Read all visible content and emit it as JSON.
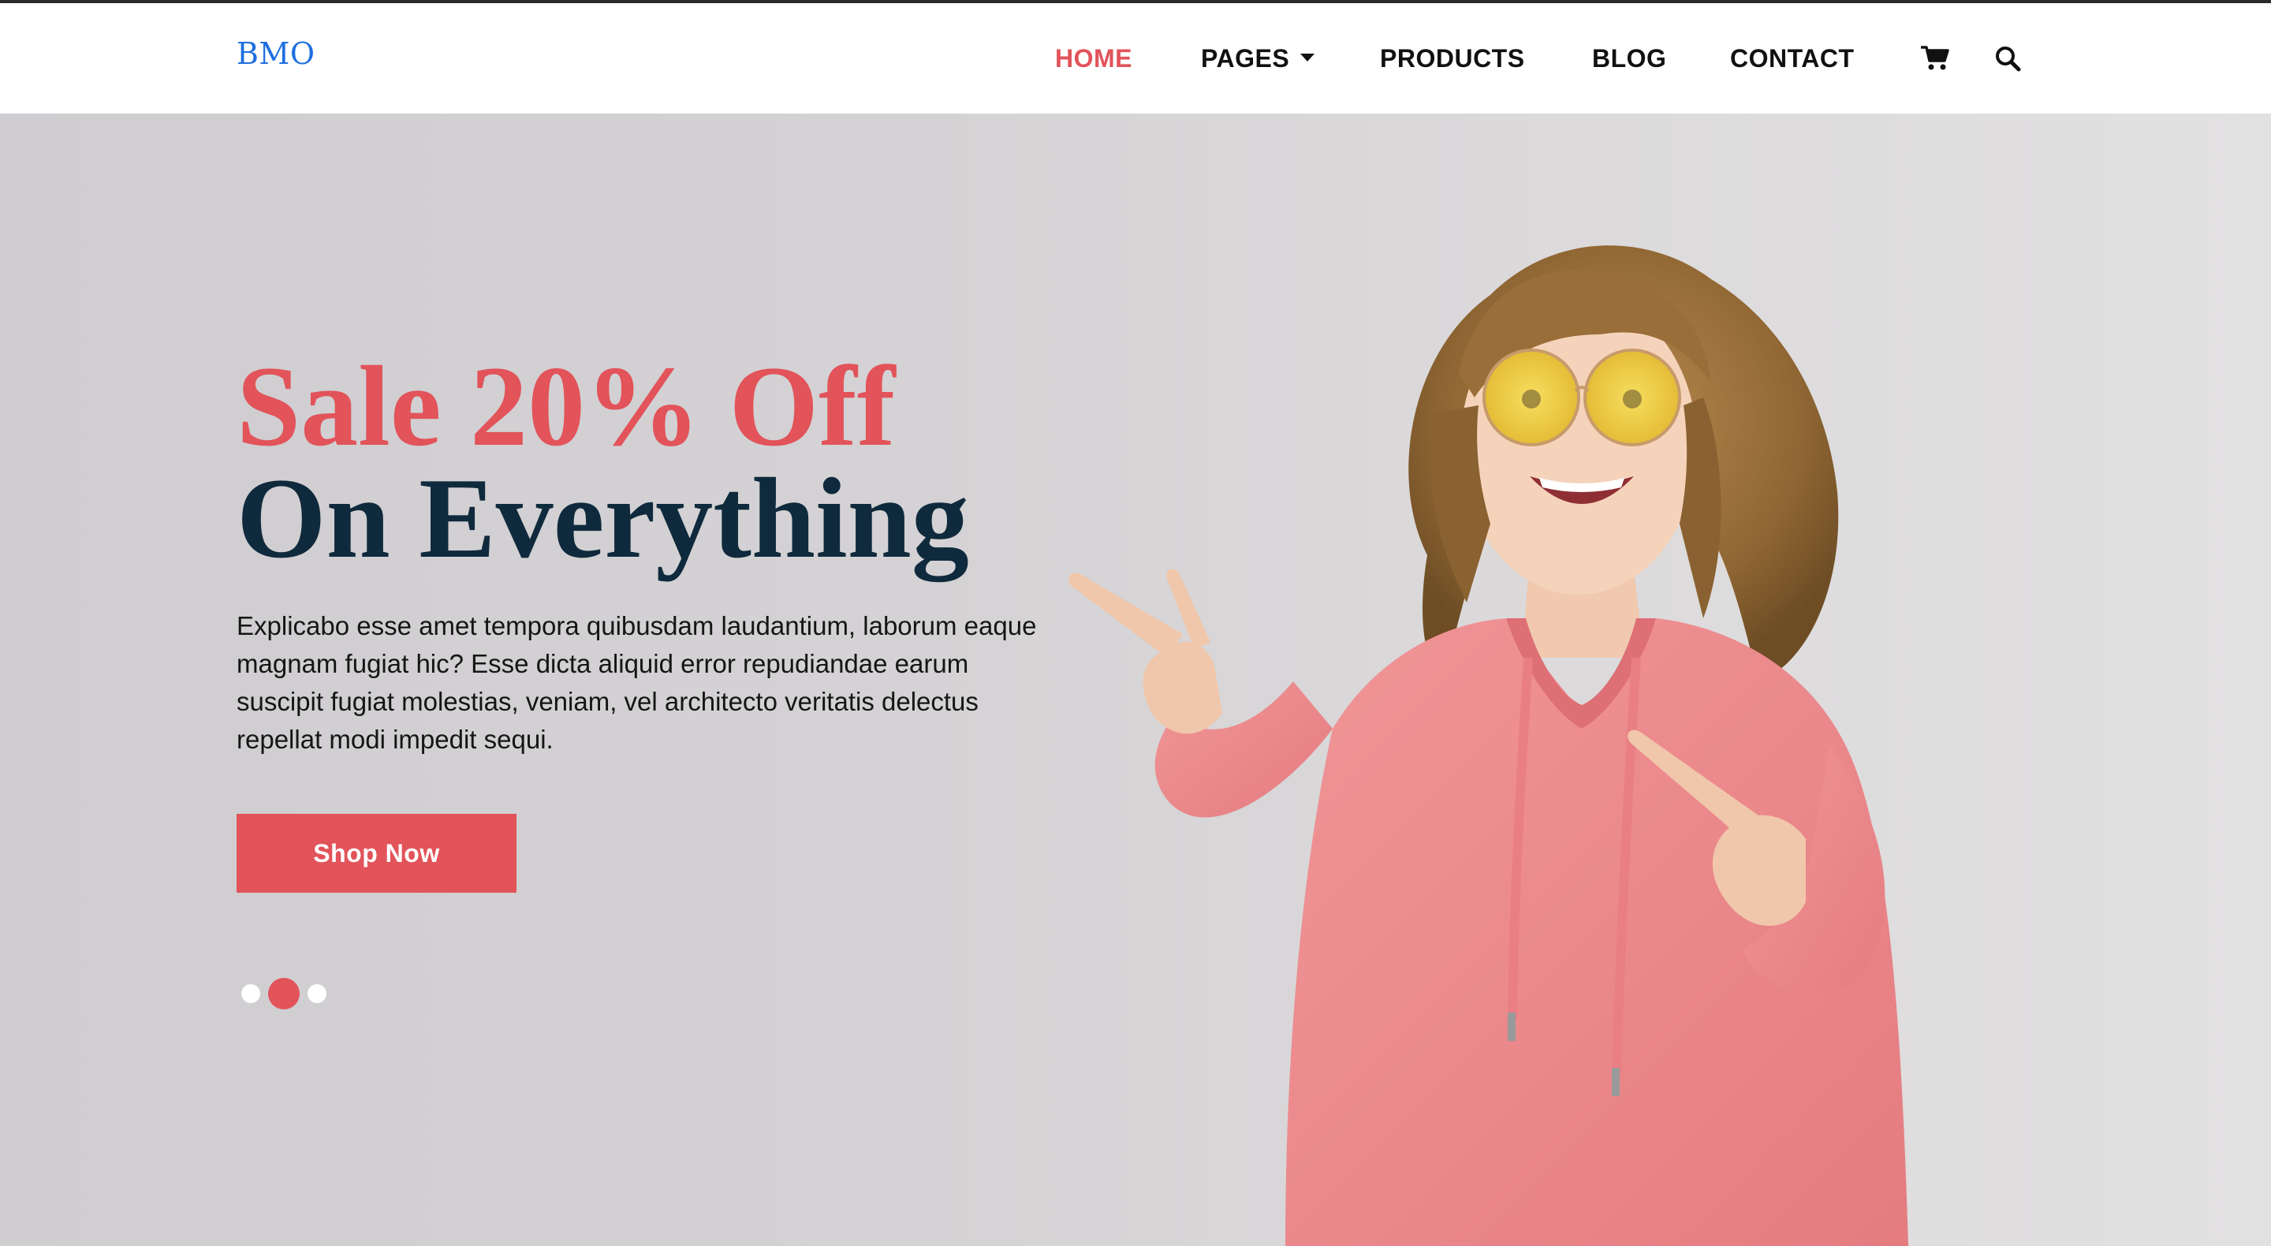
{
  "brand": {
    "logo": "BMO",
    "logo_color": "#1f6fe0"
  },
  "nav": {
    "items": [
      {
        "label": "HOME",
        "active": true
      },
      {
        "label": "PAGES",
        "has_dropdown": true
      },
      {
        "label": "PRODUCTS"
      },
      {
        "label": "BLOG"
      },
      {
        "label": "CONTACT"
      }
    ],
    "icons": [
      "cart-icon",
      "search-icon"
    ]
  },
  "hero": {
    "headline_line1": "Sale 20% Off",
    "headline_line2": "On Everything",
    "description": "Explicabo esse amet tempora quibusdam laudantium, laborum eaque magnam fugiat hic? Esse dicta aliquid error repudiandae earum suscipit fugiat molestias, veniam, vel architecto veritatis delectus repellat modi impedit sequi.",
    "cta_label": "Shop Now",
    "slider": {
      "count": 3,
      "active_index": 2
    }
  },
  "colors": {
    "accent": "#e2535a",
    "headline_dark": "#0f2a3c",
    "hero_background": "#d3d2d4",
    "hoodie": "#ee8a8c"
  }
}
